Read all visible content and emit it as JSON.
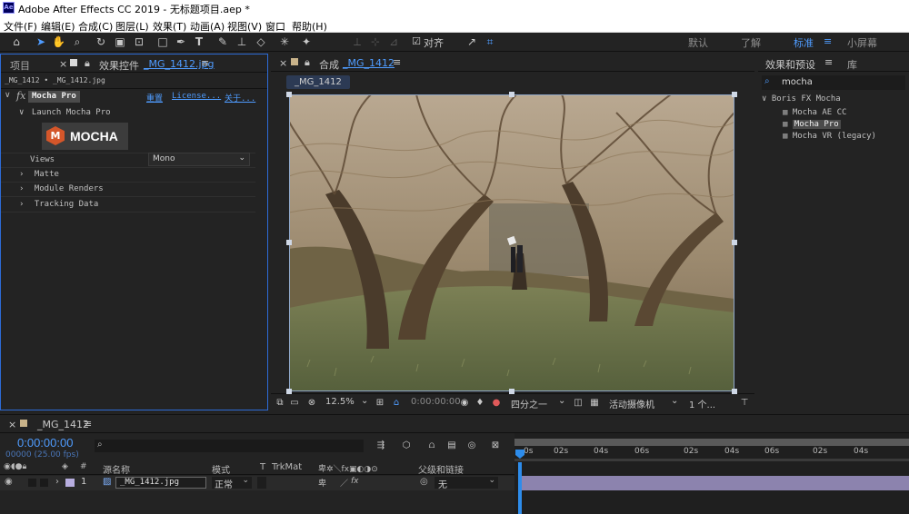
{
  "window": {
    "title": "Adobe After Effects CC 2019 - 无标题项目.aep *",
    "app_icon": "Ae"
  },
  "menu": [
    "文件(F)",
    "编辑(E)",
    "合成(C)",
    "图层(L)",
    "效果(T)",
    "动画(A)",
    "视图(V)",
    "窗口",
    "帮助(H)"
  ],
  "toolbar": {
    "snap_label": "对齐",
    "workspaces": [
      "默认",
      "了解",
      "标准",
      "小屏幕"
    ],
    "active_workspace": "标准"
  },
  "left_panel": {
    "tab_project": "项目",
    "tab_effects_prefix": "效果控件",
    "tab_effects_file": "_MG_1412.jpg",
    "breadcrumb": "_MG_1412 • _MG_1412.jpg",
    "effect_name": "Mocha Pro",
    "reset": "重置",
    "license": "License...",
    "about": "关于...",
    "launch": "Launch Mocha Pro",
    "logo_text": "MOCHA",
    "views_label": "Views",
    "views_value": "Mono",
    "groups": [
      "Matte",
      "Module Renders",
      "Tracking Data"
    ]
  },
  "center_panel": {
    "tab_comp_prefix": "合成",
    "tab_comp_name": "_MG_1412",
    "comp_chip": "_MG_1412",
    "zoom": "12.5%",
    "timecode": "0:00:00:00",
    "resolution": "四分之一",
    "camera": "活动摄像机",
    "views": "1 个..."
  },
  "right_panel": {
    "tab_effects": "效果和预设",
    "tab_library": "库",
    "search_value": "mocha",
    "category": "Boris FX Mocha",
    "items": [
      "Mocha AE CC",
      "Mocha Pro",
      "Mocha VR (legacy)"
    ],
    "selected_item": "Mocha Pro"
  },
  "timeline": {
    "tab_name": "_MG_1412",
    "timecode": "0:00:00:00",
    "fps": "00000 (25.00 fps)",
    "search_placeholder": "",
    "col_number": "#",
    "col_source": "源名称",
    "col_mode": "模式",
    "col_t": "T",
    "col_trkmat": "TrkMat",
    "col_parent": "父级和链接",
    "layer": {
      "index": "1",
      "name": "_MG_1412.jpg",
      "mode": "正常",
      "parent": "无"
    },
    "ruler": [
      "0s",
      "02s",
      "04s",
      "06s",
      "02s",
      "04s",
      "06s",
      "02s",
      "04s"
    ]
  },
  "colors": {
    "accent": "#2d8ceb",
    "selection_border": "#2d6bd6",
    "bg": "#232323"
  }
}
